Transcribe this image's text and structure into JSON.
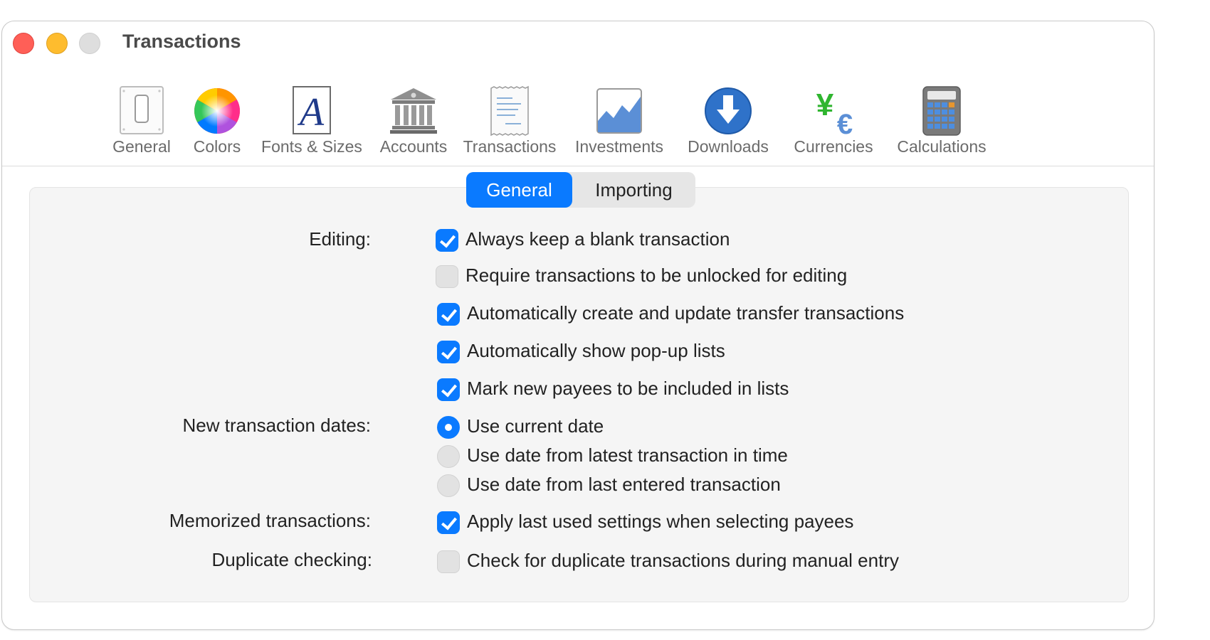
{
  "window": {
    "title": "Transactions"
  },
  "toolbar": {
    "items": [
      {
        "label": "General",
        "icon": "general-icon"
      },
      {
        "label": "Colors",
        "icon": "colors-icon"
      },
      {
        "label": "Fonts & Sizes",
        "icon": "fonts-icon"
      },
      {
        "label": "Accounts",
        "icon": "bank-icon"
      },
      {
        "label": "Transactions",
        "icon": "receipt-icon"
      },
      {
        "label": "Investments",
        "icon": "chart-icon"
      },
      {
        "label": "Downloads",
        "icon": "download-icon"
      },
      {
        "label": "Currencies",
        "icon": "currency-icon"
      },
      {
        "label": "Calculations",
        "icon": "calculator-icon"
      }
    ]
  },
  "tabs": {
    "general": "General",
    "importing": "Importing",
    "selected": "General"
  },
  "editing": {
    "label": "Editing:",
    "options": [
      {
        "text": "Always keep a blank transaction",
        "checked": true
      },
      {
        "text": "Require transactions to be unlocked for editing",
        "checked": false
      },
      {
        "text": "Automatically create and update transfer transactions",
        "checked": true
      },
      {
        "text": "Automatically show pop-up lists",
        "checked": true
      },
      {
        "text": "Mark new payees to be included in lists",
        "checked": true
      }
    ]
  },
  "dates": {
    "label": "New transaction dates:",
    "options": [
      {
        "text": "Use current date",
        "selected": true
      },
      {
        "text": "Use date from latest transaction in time",
        "selected": false
      },
      {
        "text": "Use date from last entered transaction",
        "selected": false
      }
    ]
  },
  "memorized": {
    "label": "Memorized transactions:",
    "option": {
      "text": "Apply last used settings when selecting payees",
      "checked": true
    }
  },
  "duplicate": {
    "label": "Duplicate checking:",
    "option": {
      "text": "Check for duplicate transactions during manual entry",
      "checked": false
    }
  },
  "colors": {
    "accent": "#0a7aff",
    "close": "#ff5f57",
    "minimize": "#febc2e",
    "zoom": "#dedede"
  }
}
